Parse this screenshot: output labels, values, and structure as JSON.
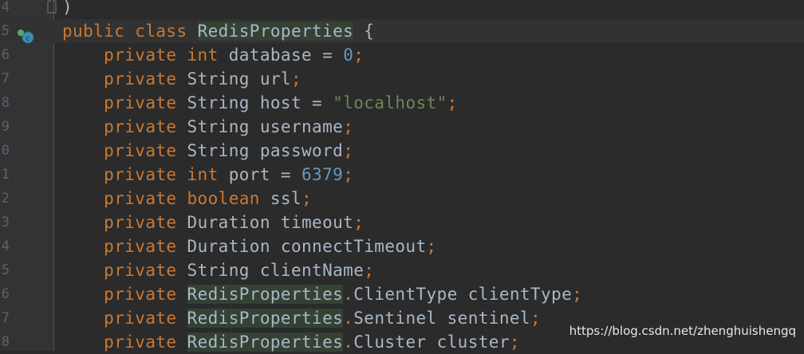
{
  "editor": {
    "lines": [
      {
        "number": "4",
        "tokens": [
          {
            "t": ")",
            "c": "plain"
          }
        ]
      },
      {
        "number": "5",
        "tokens": [
          {
            "t": "public class ",
            "c": "kw"
          },
          {
            "t": "RedisProperties",
            "c": "hl"
          },
          {
            "t": " {",
            "c": "plain"
          }
        ]
      },
      {
        "number": "6",
        "tokens": [
          {
            "t": "    private int ",
            "c": "kw"
          },
          {
            "t": "database = ",
            "c": "plain"
          },
          {
            "t": "0",
            "c": "num"
          },
          {
            "t": ";",
            "c": "punc"
          }
        ]
      },
      {
        "number": "7",
        "tokens": [
          {
            "t": "    private ",
            "c": "kw"
          },
          {
            "t": "String url",
            "c": "plain"
          },
          {
            "t": ";",
            "c": "punc"
          }
        ]
      },
      {
        "number": "8",
        "tokens": [
          {
            "t": "    private ",
            "c": "kw"
          },
          {
            "t": "String host = ",
            "c": "plain"
          },
          {
            "t": "\"localhost\"",
            "c": "str"
          },
          {
            "t": ";",
            "c": "punc"
          }
        ]
      },
      {
        "number": "9",
        "tokens": [
          {
            "t": "    private ",
            "c": "kw"
          },
          {
            "t": "String username",
            "c": "plain"
          },
          {
            "t": ";",
            "c": "punc"
          }
        ]
      },
      {
        "number": "0",
        "tokens": [
          {
            "t": "    private ",
            "c": "kw"
          },
          {
            "t": "String password",
            "c": "plain"
          },
          {
            "t": ";",
            "c": "punc"
          }
        ]
      },
      {
        "number": "1",
        "tokens": [
          {
            "t": "    private int ",
            "c": "kw"
          },
          {
            "t": "port = ",
            "c": "plain"
          },
          {
            "t": "6379",
            "c": "num"
          },
          {
            "t": ";",
            "c": "punc"
          }
        ]
      },
      {
        "number": "2",
        "tokens": [
          {
            "t": "    private boolean ",
            "c": "kw"
          },
          {
            "t": "ssl",
            "c": "plain"
          },
          {
            "t": ";",
            "c": "punc"
          }
        ]
      },
      {
        "number": "3",
        "tokens": [
          {
            "t": "    private ",
            "c": "kw"
          },
          {
            "t": "Duration timeout",
            "c": "plain"
          },
          {
            "t": ";",
            "c": "punc"
          }
        ]
      },
      {
        "number": "4",
        "tokens": [
          {
            "t": "    private ",
            "c": "kw"
          },
          {
            "t": "Duration connectTimeout",
            "c": "plain"
          },
          {
            "t": ";",
            "c": "punc"
          }
        ]
      },
      {
        "number": "5",
        "tokens": [
          {
            "t": "    private ",
            "c": "kw"
          },
          {
            "t": "String clientName",
            "c": "plain"
          },
          {
            "t": ";",
            "c": "punc"
          }
        ]
      },
      {
        "number": "6",
        "tokens": [
          {
            "t": "    private ",
            "c": "kw"
          },
          {
            "t": "RedisProperties",
            "c": "hl"
          },
          {
            "t": ".",
            "c": "punc"
          },
          {
            "t": "ClientType clientType",
            "c": "plain"
          },
          {
            "t": ";",
            "c": "punc"
          }
        ]
      },
      {
        "number": "7",
        "tokens": [
          {
            "t": "    private ",
            "c": "kw"
          },
          {
            "t": "RedisProperties",
            "c": "hl"
          },
          {
            "t": ".",
            "c": "punc"
          },
          {
            "t": "Sentinel sentinel",
            "c": "plain"
          },
          {
            "t": ";",
            "c": "punc"
          }
        ]
      },
      {
        "number": "8",
        "tokens": [
          {
            "t": "    private ",
            "c": "kw"
          },
          {
            "t": "RedisProperties",
            "c": "hl"
          },
          {
            "t": ".",
            "c": "punc"
          },
          {
            "t": "Cluster cluster",
            "c": "plain"
          },
          {
            "t": ";",
            "c": "punc"
          }
        ]
      }
    ],
    "current_line_index": 1,
    "gutter_icons": {
      "class_icon": "implemented-class-icon"
    }
  },
  "watermark": "https://blog.csdn.net/zhenghuishengq",
  "colors": {
    "background": "#2b2b2b",
    "gutter": "#313335",
    "keyword": "#cc7832",
    "string": "#6a8759",
    "number": "#6897bb",
    "text": "#a9b7c6"
  }
}
